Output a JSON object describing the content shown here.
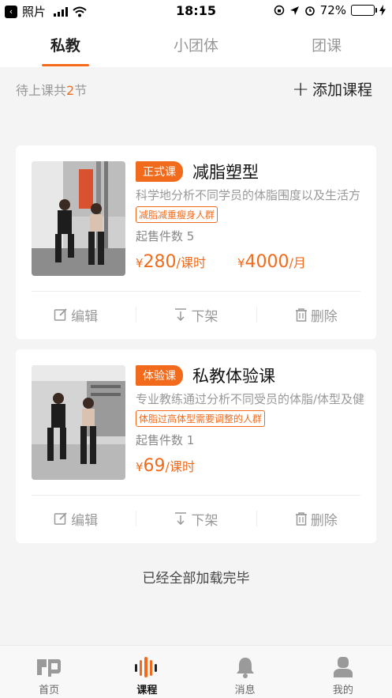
{
  "status_bar": {
    "back_app": "照片",
    "time": "18:15",
    "battery": "72%",
    "battery_level": 0.72
  },
  "tabs": [
    {
      "label": "私教"
    },
    {
      "label": "小团体"
    },
    {
      "label": "团课"
    }
  ],
  "pending": {
    "prefix": "待上课共",
    "count": "2",
    "suffix": "节"
  },
  "add_course": {
    "plus": "+",
    "label": "添加课程"
  },
  "courses": [
    {
      "badge": "正式课",
      "title": "减脂塑型",
      "desc": "科学地分析不同学员的体脂围度以及生活方",
      "tag": "减脂减重瘦身人群",
      "sold": "起售件数 5",
      "prices": [
        {
          "cur": "¥",
          "amt": "280",
          "unit": "/课时"
        },
        {
          "cur": "¥",
          "amt": "4000",
          "unit": "/月"
        }
      ],
      "actions": {
        "edit": "编辑",
        "offshelf": "下架",
        "delete": "删除"
      }
    },
    {
      "badge": "体验课",
      "title": "私教体验课",
      "desc": "专业教练通过分析不同受员的体脂/体型及健",
      "tag": "体脂过高体型需要调整的人群",
      "sold": "起售件数 1",
      "prices": [
        {
          "cur": "¥",
          "amt": "69",
          "unit": "/课时"
        }
      ],
      "actions": {
        "edit": "编辑",
        "offshelf": "下架",
        "delete": "删除"
      }
    }
  ],
  "loaded_text": "已经全部加载完毕",
  "bottom_nav": [
    {
      "label": "首页",
      "icon": "home-logo-icon"
    },
    {
      "label": "课程",
      "icon": "course-bars-icon"
    },
    {
      "label": "消息",
      "icon": "bell-icon"
    },
    {
      "label": "我的",
      "icon": "user-icon"
    }
  ],
  "colors": {
    "accent": "#f26b1d",
    "battery": "#4cd964"
  }
}
